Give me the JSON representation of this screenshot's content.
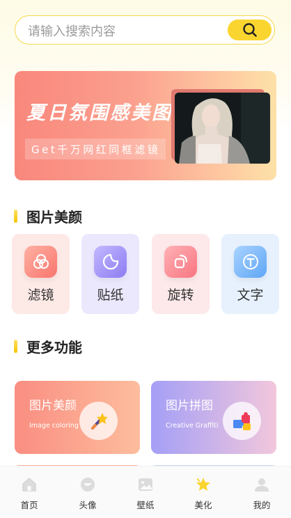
{
  "search": {
    "placeholder": "请输入搜索内容",
    "button_icon": "search-icon",
    "accent": "#fad52f"
  },
  "banner": {
    "title": "夏日氛围感美图",
    "subtitle": "Get千万网红同框滤镜"
  },
  "section_beauty": {
    "title": "图片美颜"
  },
  "tools": [
    {
      "label": "滤镜",
      "icon": "filter-icon",
      "color": "#fb8a86"
    },
    {
      "label": "贴纸",
      "icon": "sticker-icon",
      "color": "#a395f7"
    },
    {
      "label": "旋转",
      "icon": "rotate-icon",
      "color": "#fc8c8e"
    },
    {
      "label": "文字",
      "icon": "text-icon",
      "color": "#7db9fc"
    }
  ],
  "section_more": {
    "title": "更多功能"
  },
  "features": [
    {
      "title": "图片美颜",
      "subtitle": "Image coloring",
      "icon": "magic-wand-icon"
    },
    {
      "title": "图片拼图",
      "subtitle": "Creative Graffiti",
      "icon": "puzzle-icon"
    }
  ],
  "tabbar": {
    "active_index": 3,
    "items": [
      {
        "label": "首页",
        "icon": "home-icon"
      },
      {
        "label": "头像",
        "icon": "avatar-icon"
      },
      {
        "label": "壁纸",
        "icon": "wallpaper-icon"
      },
      {
        "label": "美化",
        "icon": "star-icon"
      },
      {
        "label": "我的",
        "icon": "user-icon"
      }
    ]
  }
}
